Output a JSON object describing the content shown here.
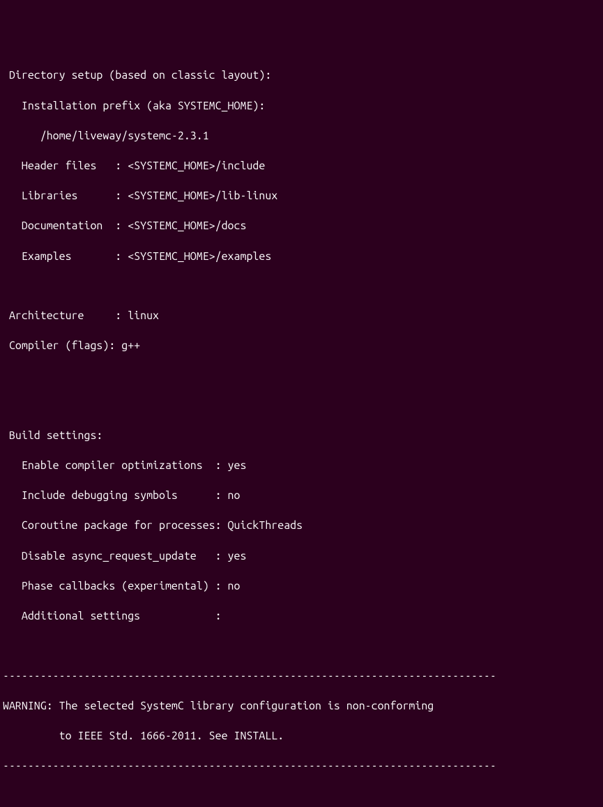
{
  "lines": {
    "l1": " Directory setup (based on classic layout):",
    "l2": "   Installation prefix (aka SYSTEMC_HOME):",
    "l3": "      /home/liveway/systemc-2.3.1",
    "l4": "   Header files   : <SYSTEMC_HOME>/include",
    "l5": "   Libraries      : <SYSTEMC_HOME>/lib-linux",
    "l6": "   Documentation  : <SYSTEMC_HOME>/docs",
    "l7": "   Examples       : <SYSTEMC_HOME>/examples",
    "l8": "",
    "l9": " Architecture     : linux",
    "l10": " Compiler (flags): g++",
    "l11": "",
    "l12": "",
    "l13": " Build settings:",
    "l14": "   Enable compiler optimizations  : yes",
    "l15": "   Include debugging symbols      : no",
    "l16": "   Coroutine package for processes: QuickThreads",
    "l17": "   Disable async_request_update   : yes",
    "l18": "   Phase callbacks (experimental) : no",
    "l19": "   Additional settings            :",
    "l20": "",
    "l21": "-------------------------------------------------------------------------------",
    "l22": "WARNING: The selected SystemC library configuration is non-conforming",
    "l23": "         to IEEE Std. 1666-2011. See INSTALL.",
    "l24": "-------------------------------------------------------------------------------"
  }
}
